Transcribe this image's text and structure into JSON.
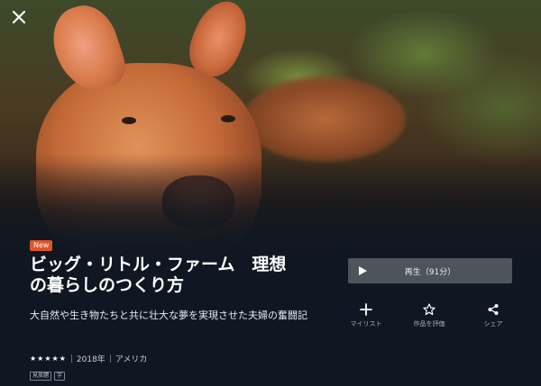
{
  "badge": {
    "new_label": "New"
  },
  "title": "ビッグ・リトル・ファーム　理想の暮らしのつくり方",
  "description": "大自然や生き物たちと共に壮大な夢を実現させた夫婦の奮闘記",
  "rating": {
    "stars": 4.5,
    "display": "★★★★★"
  },
  "meta": {
    "year": "2018年",
    "country": "アメリカ",
    "separator": "|"
  },
  "tags": [
    "見放題",
    "字"
  ],
  "play": {
    "label": "再生（91分）"
  },
  "actions": {
    "mylist": "マイリスト",
    "rate": "作品を評価",
    "share": "シェア"
  },
  "icons": {
    "close": "close-icon",
    "play": "play-icon",
    "mylist": "plus-icon",
    "rate": "star-outline-icon",
    "share": "share-icon"
  },
  "colors": {
    "background": "#0f1722",
    "badge": "#e0542a",
    "play_button": "#4e545c"
  }
}
